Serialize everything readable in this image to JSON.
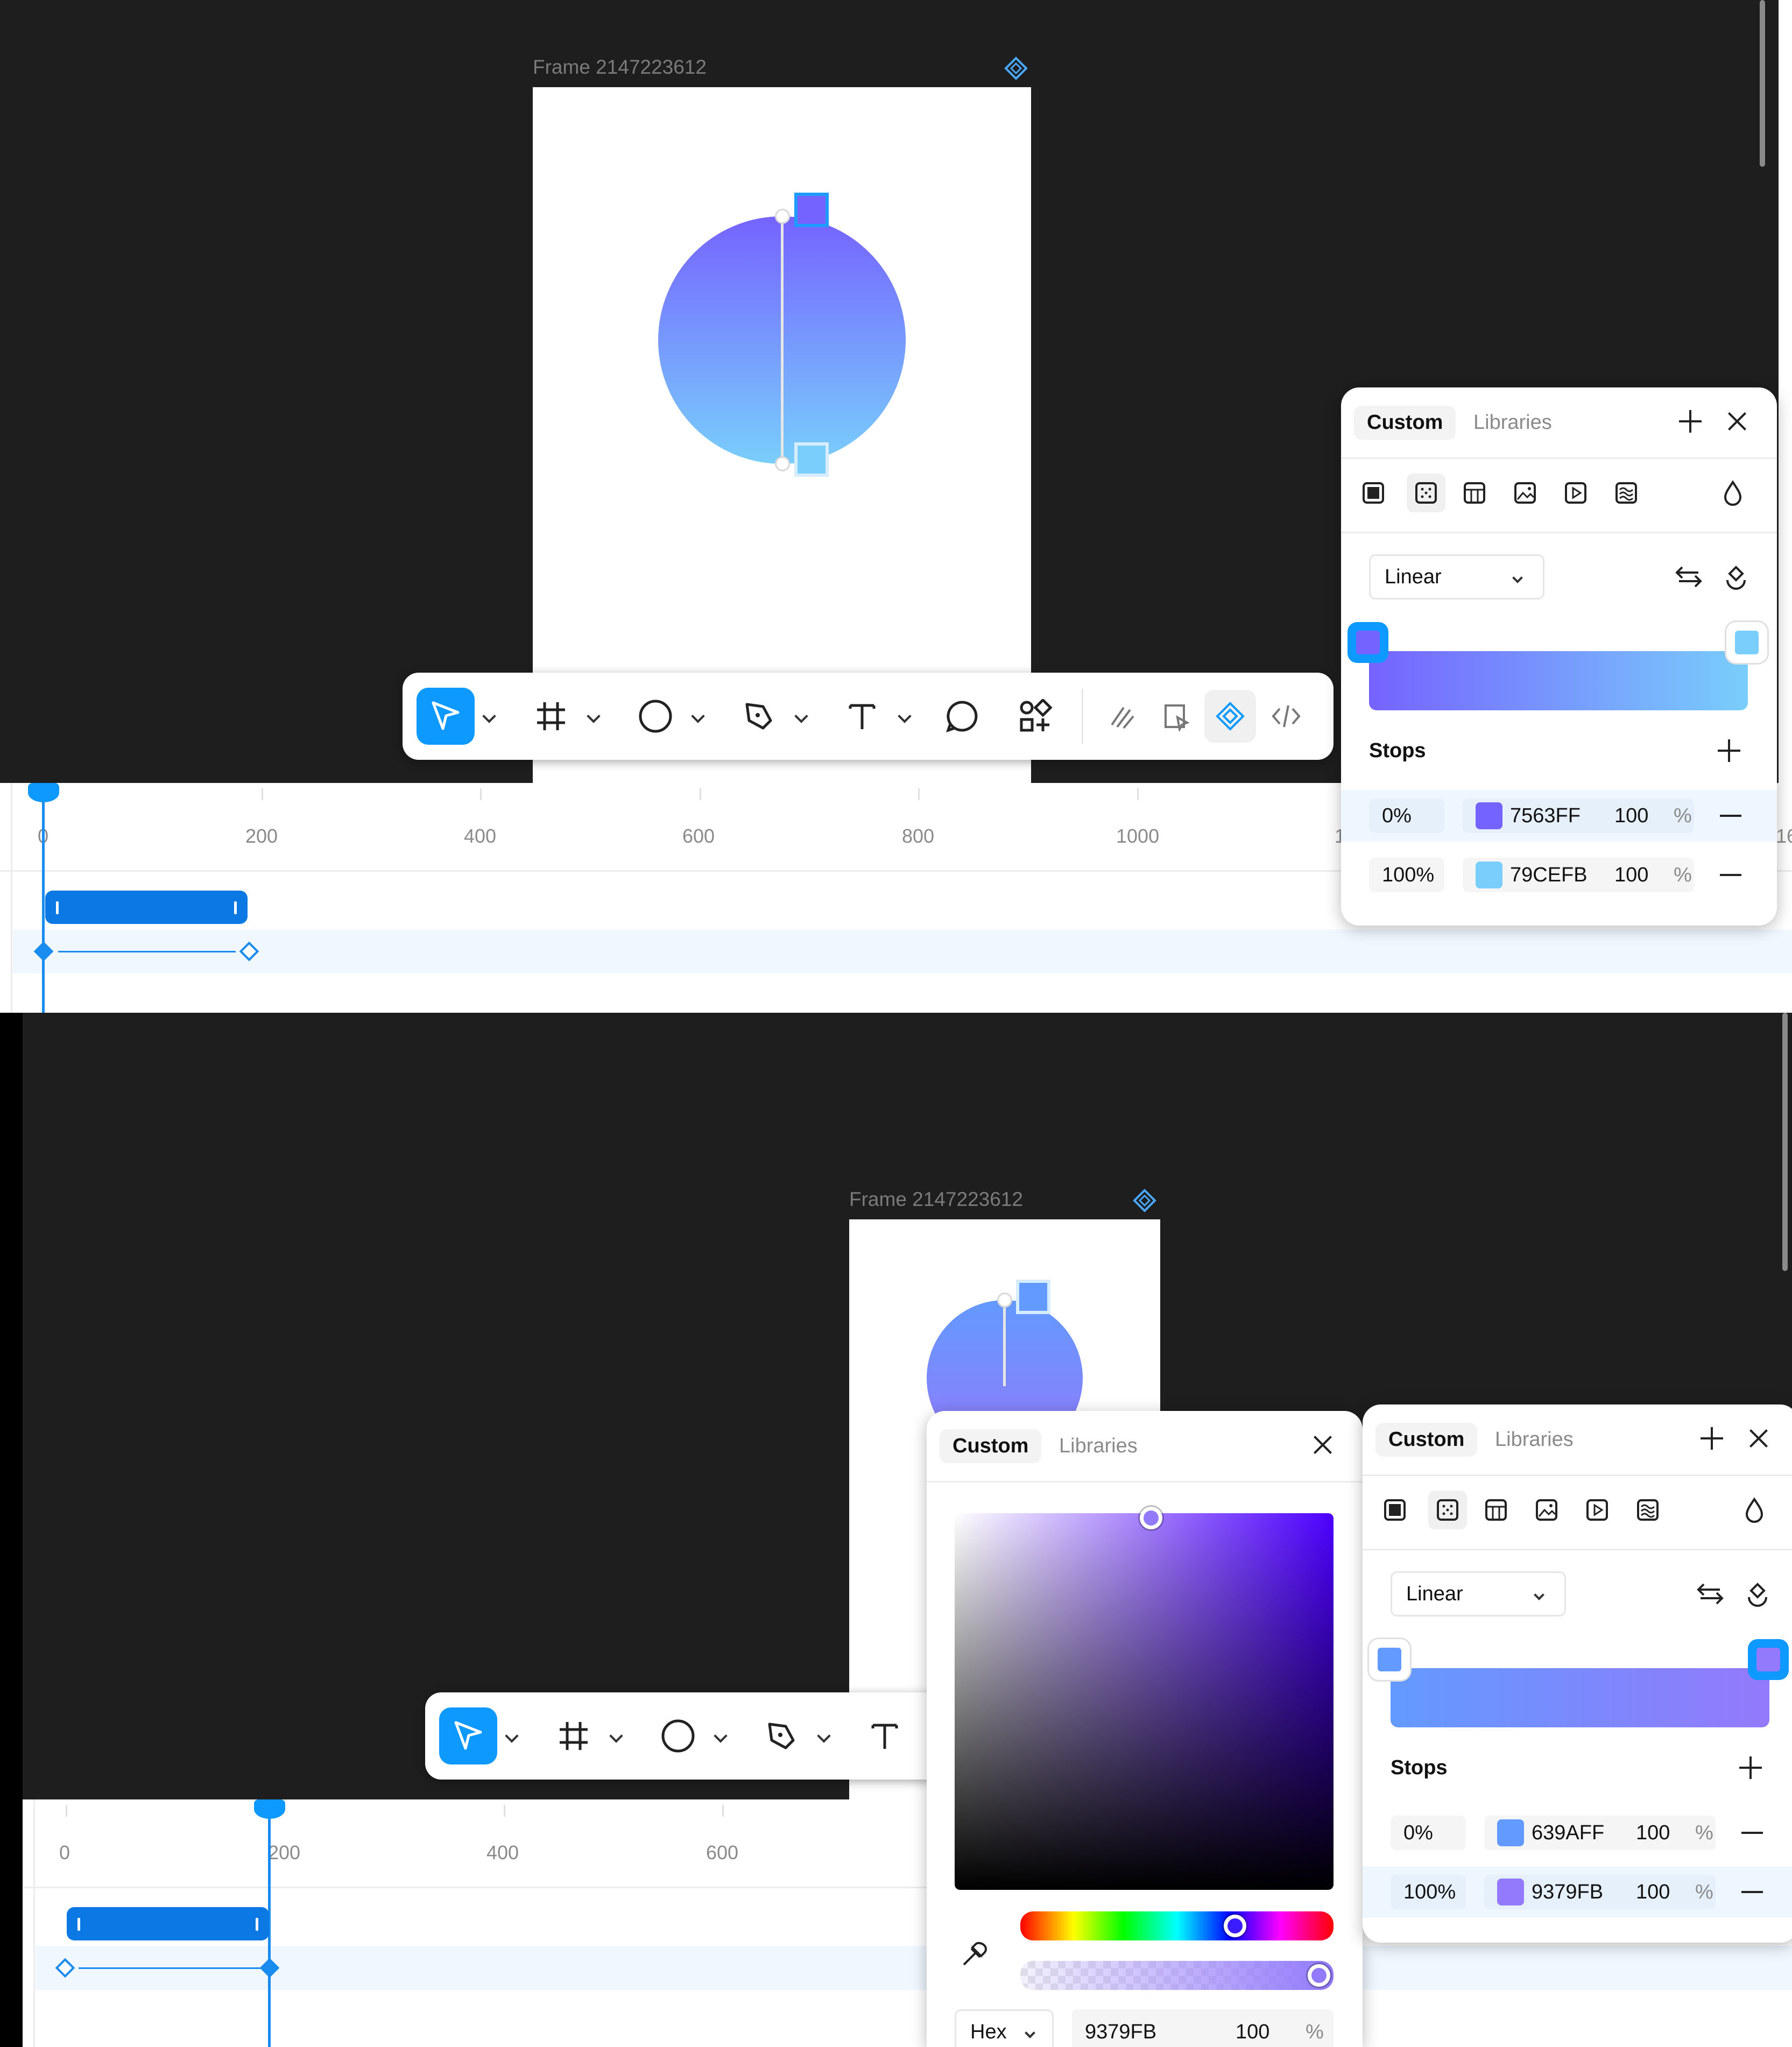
{
  "top": {
    "frame_label": "Frame 2147223612",
    "toolbar": {
      "tools": [
        "move-tool",
        "frame-tool",
        "ellipse-tool",
        "pen-tool",
        "text-tool",
        "comment-tool",
        "components-tool",
        "draw-tool",
        "dev-tool",
        "animate-tool",
        "code-tool"
      ]
    },
    "timeline": {
      "ticks": [
        "0",
        "200",
        "400",
        "600",
        "800",
        "1000",
        "1"
      ],
      "edge_label": "16"
    },
    "fill_panel": {
      "tabs": [
        "Custom",
        "Libraries"
      ],
      "gradient_type": "Linear",
      "stops_label": "Stops",
      "stops": [
        {
          "position": "0%",
          "hex": "7563FF",
          "opacity": "100",
          "unit": "%",
          "color": "#7563FF"
        },
        {
          "position": "100%",
          "hex": "79CEFB",
          "opacity": "100",
          "unit": "%",
          "color": "#79CEFB"
        }
      ]
    }
  },
  "bottom": {
    "frame_label": "Frame 2147223612",
    "timeline": {
      "ticks": [
        "0",
        "200",
        "400",
        "600"
      ]
    },
    "color_picker": {
      "tabs": [
        "Custom",
        "Libraries"
      ],
      "format": "Hex",
      "hex_value": "9379FB",
      "opacity": "100",
      "unit": "%"
    },
    "fill_panel": {
      "tabs": [
        "Custom",
        "Libraries"
      ],
      "gradient_type": "Linear",
      "stops_label": "Stops",
      "stops": [
        {
          "position": "0%",
          "hex": "639AFF",
          "opacity": "100",
          "unit": "%",
          "color": "#639AFF"
        },
        {
          "position": "100%",
          "hex": "9379FB",
          "opacity": "100",
          "unit": "%",
          "color": "#9379FB"
        }
      ]
    }
  },
  "colors": {
    "accent": "#0d99ff",
    "canvas": "#1e1e1e",
    "timeline_blue": "#0b78e3"
  }
}
